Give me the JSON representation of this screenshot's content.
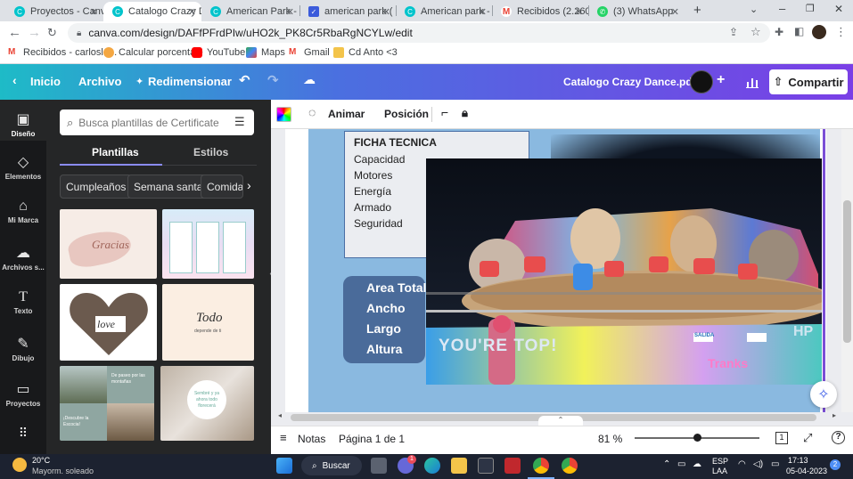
{
  "browser": {
    "tabs": [
      {
        "title": "Proyectos - Canva",
        "icon": "canva-icon",
        "color": "#00c4cc"
      },
      {
        "title": "Catalogo Crazy D",
        "icon": "canva-icon",
        "color": "#00c4cc"
      },
      {
        "title": "American Park - ",
        "icon": "canva-icon",
        "color": "#00c4cc"
      },
      {
        "title": "american park (",
        "icon": "shield-icon",
        "color": "#3b5bdb"
      },
      {
        "title": "American park - ",
        "icon": "canva-icon",
        "color": "#00c4cc"
      },
      {
        "title": "Recibidos (2.260)",
        "icon": "gmail-icon",
        "color": "#ea4335"
      },
      {
        "title": "(3) WhatsApp",
        "icon": "whatsapp-icon",
        "color": "#25d366"
      }
    ],
    "url": "canva.com/design/DAFfPFrdPIw/uHO2k_PK8Cr5RbaRgNCYLw/edit",
    "bookmarks": [
      {
        "label": "Recibidos - carlosle...",
        "icon": "gmail-icon"
      },
      {
        "label": "Calcular porcentaje",
        "icon": "calc-icon"
      },
      {
        "label": "YouTube",
        "icon": "youtube-icon"
      },
      {
        "label": "Maps",
        "icon": "maps-icon"
      },
      {
        "label": "Gmail",
        "icon": "gmail-icon"
      },
      {
        "label": "Cd Anto <3",
        "icon": "folder-icon"
      }
    ]
  },
  "header": {
    "home": "Inicio",
    "file": "Archivo",
    "resize": "Redimensionar",
    "doc_title": "Catalogo Crazy Dance.pdf",
    "share": "Compartir"
  },
  "rail": [
    {
      "label": "Diseño",
      "icon": "layout-icon"
    },
    {
      "label": "Elementos",
      "icon": "shapes-icon"
    },
    {
      "label": "Mi Marca",
      "icon": "brand-icon"
    },
    {
      "label": "Archivos s...",
      "icon": "upload-icon"
    },
    {
      "label": "Texto",
      "icon": "text-icon"
    },
    {
      "label": "Dibujo",
      "icon": "draw-icon"
    },
    {
      "label": "Proyectos",
      "icon": "folder-icon"
    },
    {
      "label": "Apps",
      "icon": "apps-icon"
    }
  ],
  "panel": {
    "search_placeholder": "Busca plantillas de Certificate",
    "tabs": [
      "Plantillas",
      "Estilos"
    ],
    "chips": [
      "Cumpleaños",
      "Semana santa",
      "Comida"
    ],
    "thumb_texts": {
      "gracias": "Gracias",
      "love": "love",
      "todo": "Todo",
      "todo_sub": "depende de ti",
      "paseo": "De paseo por las montañas",
      "descubre": "¡Descubre la Escocia!",
      "ausencia": "Sembré y ya ahora todo florecerá"
    }
  },
  "toolbar": {
    "animate": "Animar",
    "position": "Posición"
  },
  "page": {
    "ficha_title": "FICHA TECNICA",
    "ficha_rows": [
      "Capacidad",
      "Motores",
      "Energía",
      "Armado",
      "Seguridad"
    ],
    "dims": [
      "Area Total",
      "Ancho",
      "Largo",
      "Altura"
    ],
    "photo_text": "YOU'RE TOP!",
    "photo_sign": "Tranks",
    "photo_salida": "SALIDA",
    "photo_hp": "HP"
  },
  "footer": {
    "notes": "Notas",
    "pages": "Página 1 de 1",
    "zoom": "81 %",
    "zoom_level": 0.5,
    "page_count": "1"
  },
  "taskbar": {
    "temp": "20°C",
    "weather": "Mayorm. soleado",
    "search": "Buscar",
    "lang": "ESP",
    "lang2": "LAA",
    "time": "17:13",
    "date": "05-04-2023",
    "badge": "2",
    "chat_badge": "1"
  },
  "colors": {
    "accent": "#7a3fe6",
    "teal": "#1ebbc7",
    "panel_bg": "#252627",
    "rail_bg": "#18191b"
  }
}
